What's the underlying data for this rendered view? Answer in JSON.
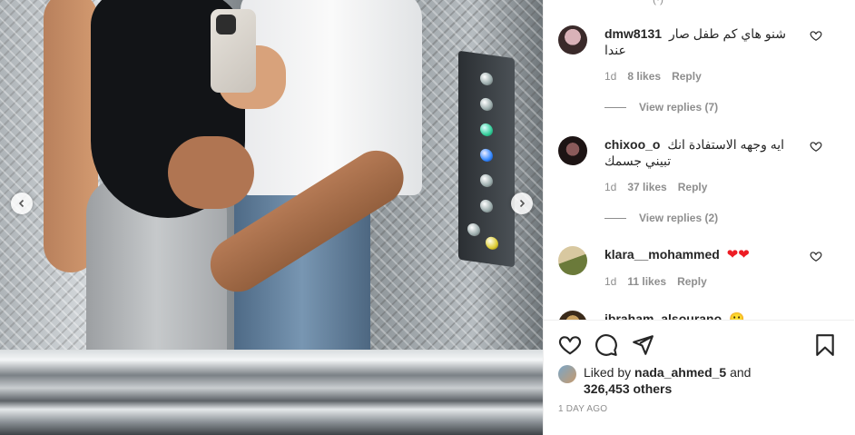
{
  "post": {
    "image_description_icon": "photo",
    "nav_prev_icon": "chevron-left-icon",
    "nav_next_icon": "chevron-right-icon"
  },
  "comments_top_cut": "(·)",
  "comments": [
    {
      "username": "dmw8131",
      "text": "شنو هاي كم طفل صار عندا",
      "time": "1d",
      "likes": "8 likes",
      "reply_label": "Reply",
      "view_replies": "View replies (7)",
      "avatar_colors": [
        "#3a2a2a",
        "#d9b2b8"
      ]
    },
    {
      "username": "chixoo_o",
      "text": "ايه وجهه الاستفادة انك تبيني جسمك",
      "time": "1d",
      "likes": "37 likes",
      "reply_label": "Reply",
      "view_replies": "View replies (2)",
      "avatar_colors": [
        "#1d1414",
        "#8a5a5a"
      ]
    },
    {
      "username": "klara__mohammed",
      "text": "❤❤",
      "time": "1d",
      "likes": "11 likes",
      "reply_label": "Reply",
      "avatar_colors": [
        "#6b7a3a",
        "#d8c8a0"
      ]
    },
    {
      "username": "ibraham_alsourano",
      "text": "😮",
      "avatar_colors": [
        "#3a2a1a",
        "#c8a060"
      ]
    }
  ],
  "actions": {
    "like_icon": "heart-outline-icon",
    "comment_icon": "comment-bubble-icon",
    "share_icon": "paper-plane-icon",
    "save_icon": "bookmark-icon"
  },
  "likes_summary": {
    "prefix": "Liked by ",
    "user": "nada_ahmed_5",
    "mid": " and",
    "count": "326,453 others"
  },
  "timestamp": "1 DAY AGO",
  "colors": {
    "text_primary": "#262626",
    "text_secondary": "#8e8e8e",
    "heart_red": "#ed1c24"
  }
}
